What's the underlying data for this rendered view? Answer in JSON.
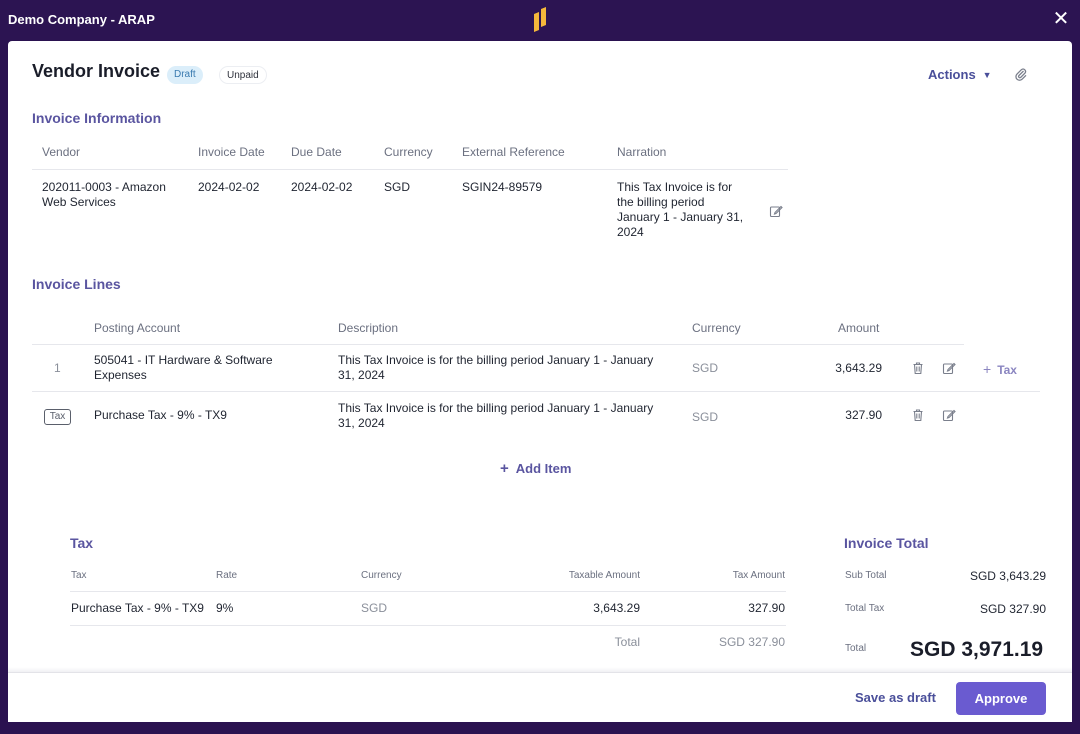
{
  "app": {
    "title": "Demo Company - ARAP"
  },
  "header": {
    "title": "Vendor Invoice",
    "badges": {
      "draft": "Draft",
      "unpaid": "Unpaid"
    },
    "actions_label": "Actions",
    "icons": {
      "actions_chevron": "chevron-down-icon",
      "attach": "paperclip-icon",
      "close": "close-icon"
    }
  },
  "invoice_info": {
    "section_title": "Invoice Information",
    "headers": {
      "vendor": "Vendor",
      "invoice_date": "Invoice Date",
      "due_date": "Due Date",
      "currency": "Currency",
      "external_reference": "External Reference",
      "narration": "Narration"
    },
    "values": {
      "vendor_line1": "202011-0003 - Amazon",
      "vendor_line2": "Web Services",
      "invoice_date": "2024-02-02",
      "due_date": "2024-02-02",
      "currency": "SGD",
      "external_reference": "SGIN24-89579",
      "narration_line1": "This Tax Invoice is for",
      "narration_line2": "the billing period",
      "narration_line3": "January 1 - January 31,",
      "narration_line4": "2024"
    }
  },
  "invoice_lines": {
    "section_title": "Invoice Lines",
    "headers": {
      "posting_account": "Posting Account",
      "description": "Description",
      "currency": "Currency",
      "amount": "Amount"
    },
    "rows": [
      {
        "index": "1",
        "account_line1": "505041 - IT Hardware & Software",
        "account_line2": "Expenses",
        "description_line1": "This Tax Invoice is for the billing period January 1 - January",
        "description_line2": "31, 2024",
        "currency": "SGD",
        "amount": "3,643.29",
        "add_tax_label": "Tax"
      },
      {
        "tag": "Tax",
        "account_line1": "Purchase Tax - 9% - TX9",
        "description_line1": "This Tax Invoice is for the billing period January 1 - January",
        "description_line2": "31, 2024",
        "currency": "SGD",
        "amount": "327.90"
      }
    ],
    "add_item_label": "Add Item"
  },
  "tax": {
    "section_title": "Tax",
    "headers": {
      "tax": "Tax",
      "rate": "Rate",
      "currency": "Currency",
      "taxable_amount": "Taxable Amount",
      "tax_amount": "Tax Amount"
    },
    "rows": [
      {
        "tax": "Purchase Tax - 9% - TX9",
        "rate": "9%",
        "currency": "SGD",
        "taxable_amount": "3,643.29",
        "tax_amount": "327.90"
      }
    ],
    "total_label": "Total",
    "total_value": "SGD 327.90"
  },
  "invoice_total": {
    "section_title": "Invoice Total",
    "sub_total_label": "Sub Total",
    "sub_total_value": "SGD 3,643.29",
    "total_tax_label": "Total Tax",
    "total_tax_value": "SGD 327.90",
    "total_label": "Total",
    "total_value": "SGD 3,971.19"
  },
  "footer": {
    "save_draft_label": "Save as draft",
    "approve_label": "Approve"
  },
  "colors": {
    "brand_purple": "#2c1452",
    "accent": "#6a5bd0",
    "section_title": "#5a55a0",
    "draft_badge_bg": "#dbeefa"
  }
}
